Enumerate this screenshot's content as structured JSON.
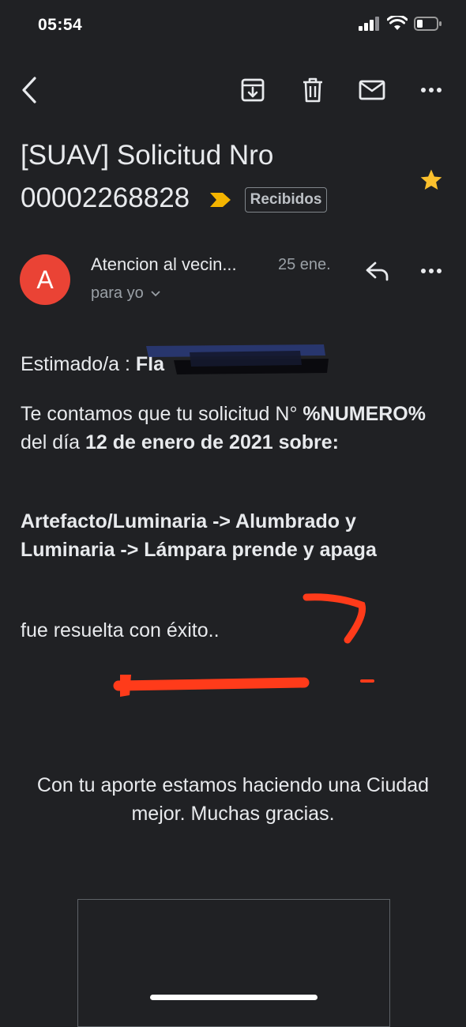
{
  "status_bar": {
    "time": "05:54"
  },
  "email": {
    "subject": "[SUAV] Solicitud Nro 00002268828",
    "label": "Recibidos",
    "sender": {
      "initial": "A",
      "name": "Atencion al vecin...",
      "date": "25 ene.",
      "recipient": "para yo"
    },
    "body": {
      "greeting": "Estimado/a :",
      "greeting_name_fragment": "Fla",
      "p1_a": "Te contamos que tu solicitud N°",
      "p1_number": "%NUMERO%",
      "p1_b": "del día",
      "p1_date": "12 de enero de 2021 sobre:",
      "category": "Artefacto/Luminaria -> Alumbrado y Luminaria -> Lámpara prende y apaga",
      "result": "fue resuelta con éxito..",
      "footer": "Con tu aporte estamos haciendo una Ciudad mejor. Muchas gracias."
    }
  },
  "colors": {
    "background": "#202124",
    "avatar": "#ea4335",
    "star": "#fbc02d",
    "important_marker": "#f4b400",
    "scribble": "#ff3b1a"
  },
  "icons": [
    "back-icon",
    "archive-icon",
    "delete-icon",
    "mail-icon",
    "more-icon",
    "star-icon",
    "reply-icon",
    "chevron-down-icon"
  ]
}
